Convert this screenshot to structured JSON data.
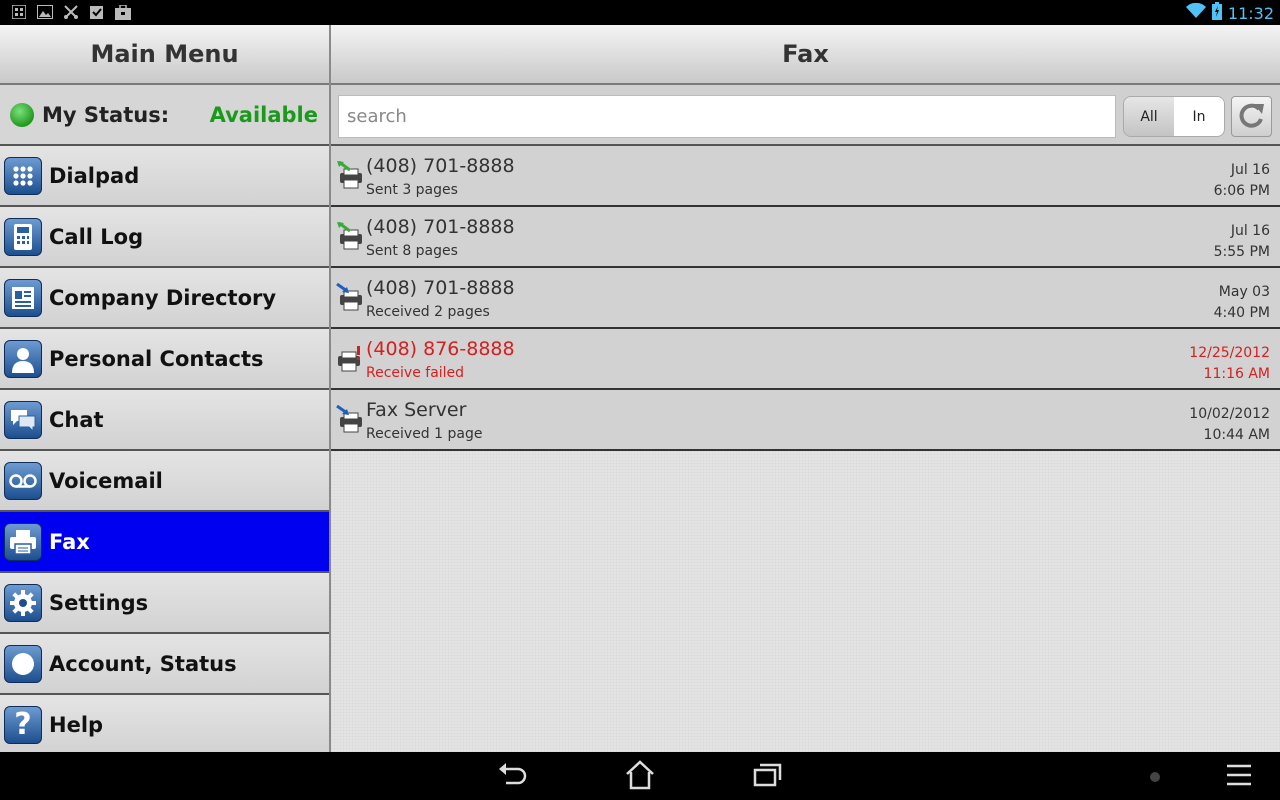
{
  "status_bar": {
    "time": "11:32",
    "icons": [
      "grid-icon",
      "image-icon",
      "tools-icon",
      "clipboard-check-icon",
      "briefcase-icon",
      "wifi-icon",
      "battery-charging-icon"
    ]
  },
  "sidebar": {
    "title": "Main Menu",
    "status": {
      "label": "My Status:",
      "value": "Available",
      "color": "#1a9a1a"
    },
    "items": [
      {
        "label": "Dialpad",
        "icon": "dialpad-icon"
      },
      {
        "label": "Call Log",
        "icon": "call-log-icon"
      },
      {
        "label": "Company Directory",
        "icon": "company-directory-icon"
      },
      {
        "label": "Personal Contacts",
        "icon": "person-icon"
      },
      {
        "label": "Chat",
        "icon": "chat-icon"
      },
      {
        "label": "Voicemail",
        "icon": "voicemail-icon"
      },
      {
        "label": "Fax",
        "icon": "fax-icon",
        "active": true
      },
      {
        "label": "Settings",
        "icon": "gear-icon"
      },
      {
        "label": "Account, Status",
        "icon": "account-status-icon"
      },
      {
        "label": "Help",
        "icon": "help-icon"
      }
    ],
    "active_color": "#0000f0"
  },
  "main": {
    "title": "Fax",
    "search": {
      "placeholder": "search",
      "value": ""
    },
    "filter": {
      "all_label": "All",
      "in_label": "In",
      "selected": "All"
    },
    "faxes": [
      {
        "title": "(408) 701-8888",
        "subtitle": "Sent 3 pages",
        "date": "Jul 16",
        "time": "6:06 PM",
        "direction": "sent",
        "failed": false
      },
      {
        "title": "(408) 701-8888",
        "subtitle": "Sent 8 pages",
        "date": "Jul 16",
        "time": "5:55 PM",
        "direction": "sent",
        "failed": false
      },
      {
        "title": "(408) 701-8888",
        "subtitle": "Received 2 pages",
        "date": "May 03",
        "time": "4:40 PM",
        "direction": "received",
        "failed": false
      },
      {
        "title": "(408) 876-8888",
        "subtitle": "Receive failed",
        "date": "12/25/2012",
        "time": "11:16 AM",
        "direction": "failed",
        "failed": true
      },
      {
        "title": "Fax Server",
        "subtitle": "Received 1 page",
        "date": "10/02/2012",
        "time": "10:44 AM",
        "direction": "received",
        "failed": false
      }
    ],
    "failed_color": "#d42020"
  },
  "nav_bar": {
    "buttons": [
      "back-icon",
      "home-icon",
      "recent-apps-icon",
      "menu-icon"
    ]
  }
}
